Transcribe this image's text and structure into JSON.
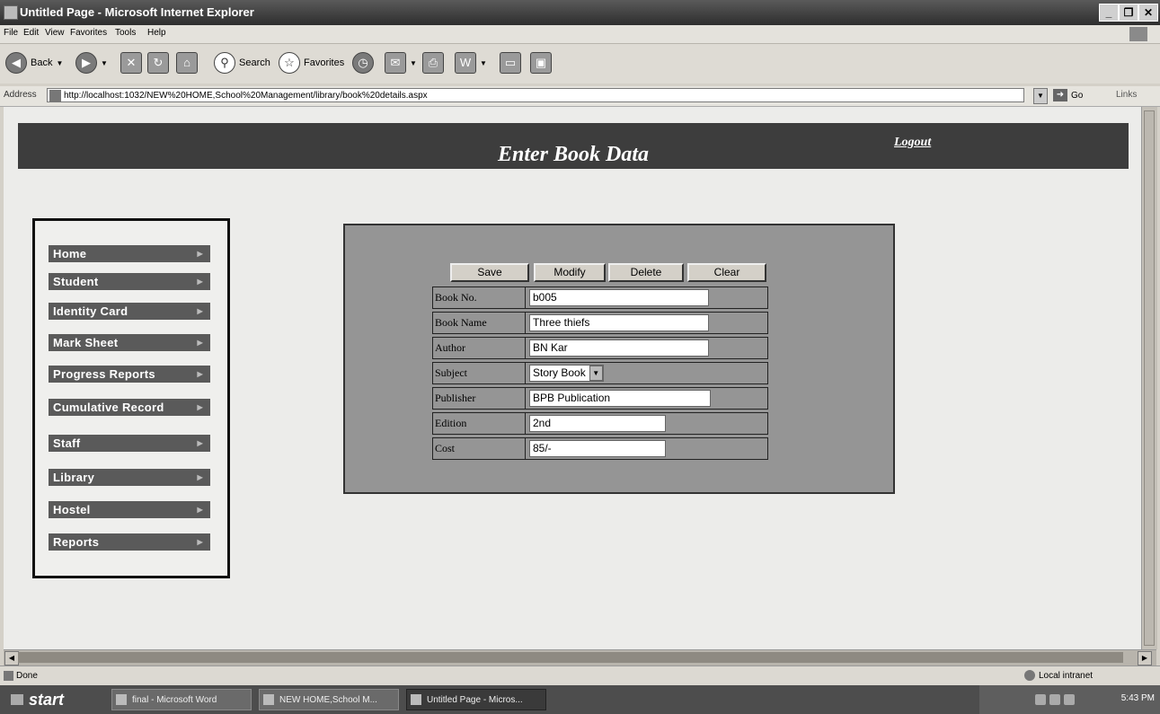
{
  "window": {
    "title": "Untitled Page - Microsoft Internet Explorer"
  },
  "menubar": {
    "items": [
      "File",
      "Edit",
      "View",
      "Favorites",
      "Tools",
      "Help"
    ]
  },
  "toolbar": {
    "back": "Back",
    "search": "Search",
    "favorites": "Favorites"
  },
  "address": {
    "label": "Address",
    "url": "http://localhost:1032/NEW%20HOME,School%20Management/library/book%20details.aspx",
    "go": "Go",
    "links": "Links"
  },
  "page": {
    "title": "Enter Book Data",
    "logout": "Logout",
    "nav": [
      "Home",
      "Student",
      "Identity Card",
      "Mark Sheet",
      "Progress Reports",
      "Cumulative Record",
      "Staff",
      "Library",
      "Hostel",
      "Reports"
    ],
    "buttons": {
      "save": "Save",
      "modify": "Modify",
      "delete": "Delete",
      "clear": "Clear"
    },
    "form": {
      "book_no": {
        "label": "Book No.",
        "value": "b005"
      },
      "book_name": {
        "label": "Book Name",
        "value": "Three thiefs"
      },
      "author": {
        "label": "Author",
        "value": "BN Kar"
      },
      "subject": {
        "label": "Subject",
        "value": "Story Book"
      },
      "publisher": {
        "label": "Publisher",
        "value": "BPB Publication"
      },
      "edition": {
        "label": "Edition",
        "value": "2nd"
      },
      "cost": {
        "label": "Cost",
        "value": "85/-"
      }
    }
  },
  "statusbar": {
    "status": "Done",
    "zone": "Local intranet"
  },
  "taskbar": {
    "start": "start",
    "tasks": [
      "final - Microsoft Word",
      "NEW HOME,School M...",
      "Untitled Page - Micros..."
    ],
    "clock": "5:43 PM"
  }
}
